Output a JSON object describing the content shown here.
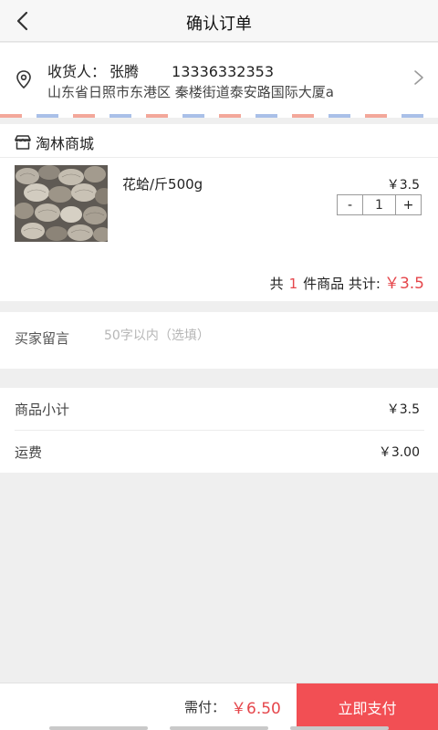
{
  "header": {
    "title": "确认订单"
  },
  "address": {
    "recipient_label": "收货人：",
    "recipient_name": "张腾",
    "phone": "13336332353",
    "detail": "山东省日照市东港区 秦楼街道泰安路国际大厦a"
  },
  "shop": {
    "name": "淘林商城",
    "product": {
      "name": "花蛤/斤500g",
      "price": "￥3.5",
      "quantity": "1",
      "minus_label": "-",
      "plus_label": "+"
    },
    "total": {
      "prefix": "共",
      "count": "1",
      "suffix": "件商品 共计:",
      "amount": "￥3.5"
    }
  },
  "remark": {
    "label": "买家留言",
    "placeholder": "50字以内（选填）"
  },
  "summary": {
    "rows": [
      {
        "label": "商品小计",
        "value": "￥3.5"
      },
      {
        "label": "运费",
        "value": "￥3.00"
      }
    ]
  },
  "bottom": {
    "pay_label": "需付：",
    "pay_amount": "￥6.50",
    "pay_button": "立即支付"
  },
  "colors": {
    "accent": "#f24f54",
    "price_red": "#e5464b",
    "stripe_red": "#f3a79a",
    "stripe_blue": "#a9c0e8"
  },
  "icons": [
    "back-arrow-icon",
    "location-pin-icon",
    "chevron-right-icon",
    "shop-icon"
  ]
}
